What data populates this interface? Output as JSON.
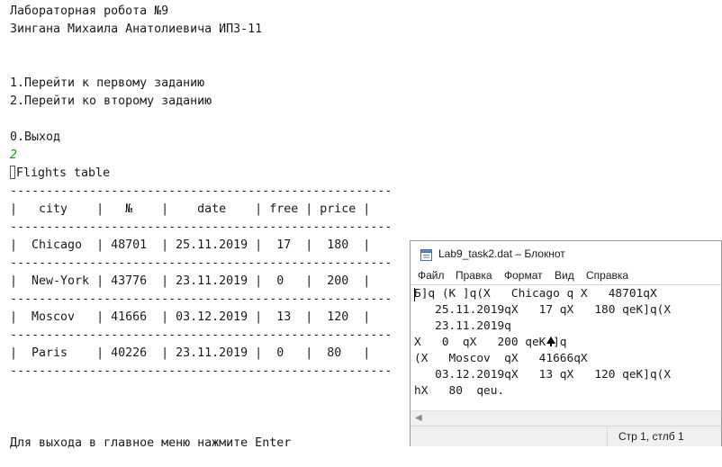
{
  "console": {
    "lines": [
      "Лабораторная робота №9",
      "Зингана Михаила Анатолиевича ИПЗ-11",
      "",
      "",
      "1.Перейти к первому заданию",
      "2.Перейти ко второму заданию",
      "",
      "0.Выход"
    ],
    "user_input": "2",
    "table_title": "Flights table",
    "divider": "-----------------------------------------------------",
    "header_row": "|   city    |   №    |    date    | free | price |",
    "rows": [
      "|  Chicago  | 48701  | 25.11.2019 |  17  |  180  |",
      "|  New-York | 43776  | 23.11.2019 |  0   |  200  |",
      "|  Moscov   | 41666  | 03.12.2019 |  13  |  120  |",
      "|  Paris    | 40226  | 23.11.2019 |  0   |  80   |"
    ],
    "exit_prompt": "Для выхода в главное меню нажмите Enter"
  },
  "notepad": {
    "title": "Lab9_task2.dat – Блокнот",
    "menu": [
      "Файл",
      "Правка",
      "Формат",
      "Вид",
      "Справка"
    ],
    "content_lines": [
      "Б]q (K ]q(X   Chicago q X   48701qX",
      "   25.11.2019qX   17 qX   180 qeK]q(X",
      "   23.11.2019q",
      "X   0  qX   200 qeK ]q",
      "(X   Moscov  qX   41666qX",
      "   03.12.2019qX   13 qX   120 qeK]q(X",
      "hX   80  qeu."
    ],
    "status": "Стр 1, стлб 1"
  }
}
